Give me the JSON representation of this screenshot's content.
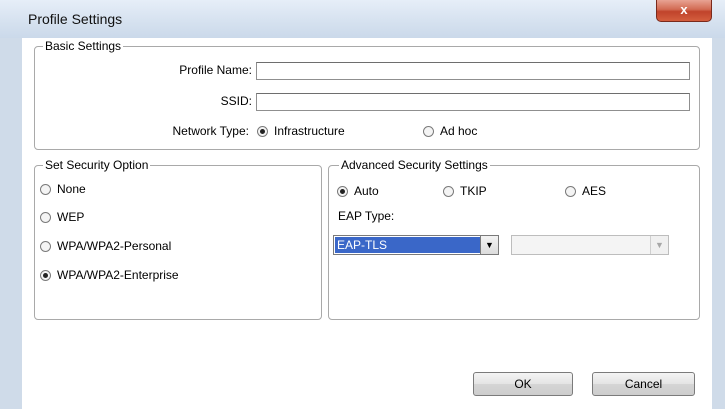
{
  "window": {
    "title": "Profile Settings",
    "close_glyph": "x"
  },
  "basic": {
    "legend": "Basic Settings",
    "profile_name_label": "Profile Name:",
    "profile_name_value": "",
    "ssid_label": "SSID:",
    "ssid_value": "",
    "network_type_label": "Network Type:",
    "network_options": [
      {
        "label": "Infrastructure",
        "selected": true
      },
      {
        "label": "Ad hoc",
        "selected": false
      }
    ]
  },
  "security": {
    "legend": "Set Security Option",
    "options": [
      {
        "label": "None",
        "selected": false
      },
      {
        "label": "WEP",
        "selected": false
      },
      {
        "label": "WPA/WPA2-Personal",
        "selected": false
      },
      {
        "label": "WPA/WPA2-Enterprise",
        "selected": true
      }
    ]
  },
  "advanced": {
    "legend": "Advanced Security Settings",
    "cipher_options": [
      {
        "label": "Auto",
        "selected": true
      },
      {
        "label": "TKIP",
        "selected": false
      },
      {
        "label": "AES",
        "selected": false
      }
    ],
    "eap_type_label": "EAP Type:",
    "eap_type_value": "EAP-TLS",
    "secondary_value": ""
  },
  "buttons": {
    "ok": "OK",
    "cancel": "Cancel"
  },
  "icons": {
    "dropdown_arrow": "▼"
  }
}
